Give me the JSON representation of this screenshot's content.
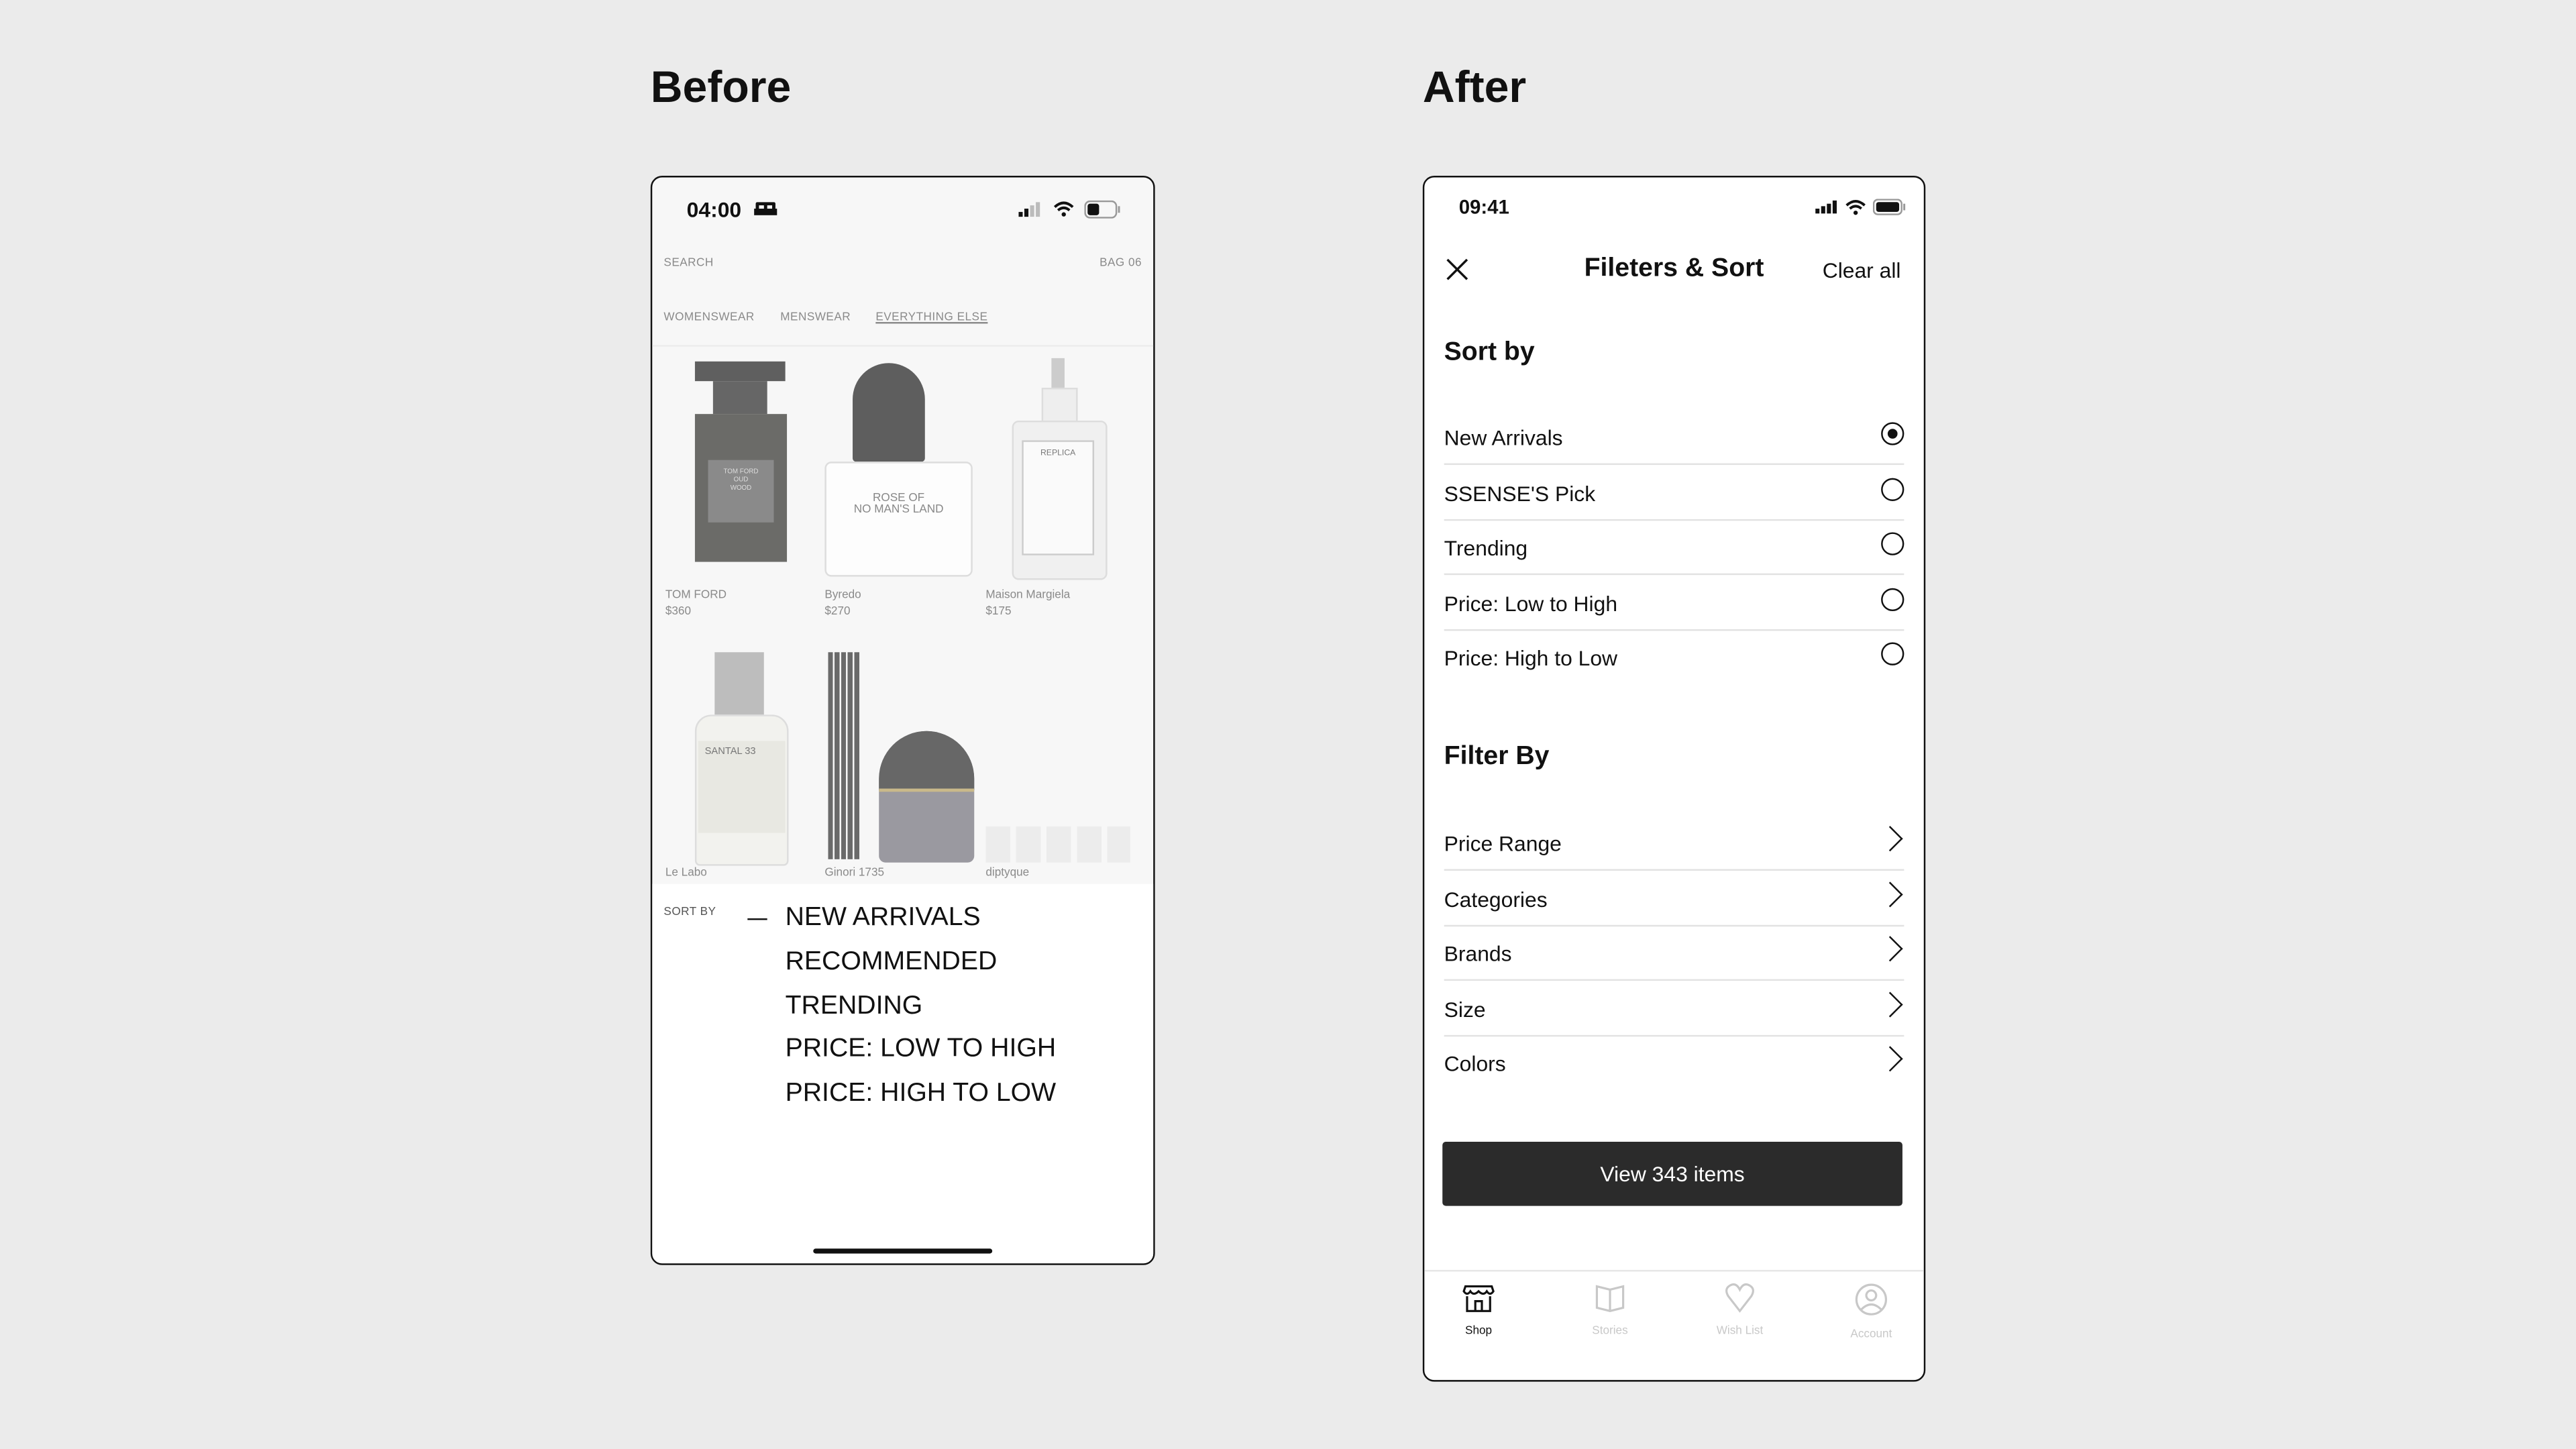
{
  "before": {
    "heading": "Before",
    "status": {
      "time": "04:00",
      "icons": [
        "bed-icon",
        "signal-icon",
        "wifi-icon",
        "battery-icon"
      ]
    },
    "header": {
      "search": "SEARCH",
      "bag": "BAG 06"
    },
    "tabs": [
      {
        "label": "WOMENSWEAR"
      },
      {
        "label": "MENSWEAR"
      },
      {
        "label": "EVERYTHING ELSE",
        "active": true
      }
    ],
    "products": [
      {
        "brand": "TOM FORD",
        "price": "$360"
      },
      {
        "brand": "Byredo",
        "price": "$270"
      },
      {
        "brand": "Maison Margiela",
        "price": "$175"
      },
      {
        "brand": "Le Labo",
        "price": ""
      },
      {
        "brand": "Ginori 1735",
        "price": ""
      },
      {
        "brand": "diptyque",
        "price": ""
      }
    ],
    "sort": {
      "label": "SORT BY",
      "options": [
        "NEW ARRIVALS",
        "RECOMMENDED",
        "TRENDING",
        "PRICE: LOW TO HIGH",
        "PRICE: HIGH TO LOW"
      ],
      "selected": "NEW ARRIVALS"
    }
  },
  "after": {
    "heading": "After",
    "status": {
      "time": "09:41",
      "icons": [
        "signal-icon",
        "wifi-icon",
        "battery-icon"
      ]
    },
    "header": {
      "title": "Fileters & Sort",
      "clear": "Clear all"
    },
    "sort_title": "Sort by",
    "sort_options": [
      {
        "label": "New Arrivals",
        "selected": true
      },
      {
        "label": "SSENSE'S Pick",
        "selected": false
      },
      {
        "label": "Trending",
        "selected": false
      },
      {
        "label": "Price: Low to High",
        "selected": false
      },
      {
        "label": "Price: High to Low",
        "selected": false
      }
    ],
    "filter_title": "Filter By",
    "filters": [
      {
        "label": "Price Range"
      },
      {
        "label": "Categories"
      },
      {
        "label": "Brands"
      },
      {
        "label": "Size"
      },
      {
        "label": "Colors"
      }
    ],
    "cta": "View 343 items",
    "tabbar": [
      {
        "label": "Shop",
        "icon": "shop-icon",
        "active": true
      },
      {
        "label": "Stories",
        "icon": "book-icon",
        "active": false
      },
      {
        "label": "Wish List",
        "icon": "heart-icon",
        "active": false
      },
      {
        "label": "Account",
        "icon": "account-icon",
        "active": false
      }
    ],
    "colors": {
      "cta_bg": "#2b2b2b",
      "inactive": "#c8c8c8"
    }
  }
}
